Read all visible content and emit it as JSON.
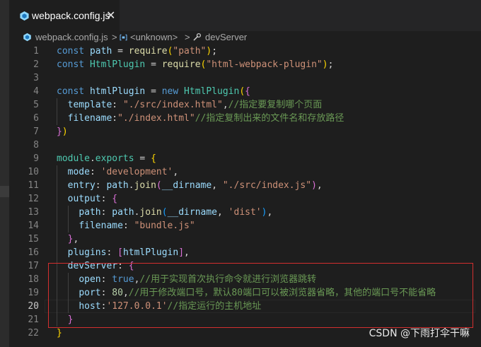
{
  "tab": {
    "title": "webpack.config.js",
    "close": "✕"
  },
  "breadcrumb": {
    "file": "webpack.config.js",
    "sep": ">",
    "symbol": "<unknown>",
    "member": "devServer"
  },
  "active_line": 20,
  "code_lines": [
    {
      "n": "1",
      "tokens": [
        [
          "kw",
          "const "
        ],
        [
          "var",
          "path"
        ],
        [
          "p",
          " = "
        ],
        [
          "fn",
          "require"
        ],
        [
          "br1",
          "("
        ],
        [
          "str",
          "\"path\""
        ],
        [
          "br1",
          ")"
        ],
        [
          "p",
          ";"
        ]
      ]
    },
    {
      "n": "2",
      "tokens": [
        [
          "kw",
          "const "
        ],
        [
          "cls",
          "HtmlPlugin"
        ],
        [
          "p",
          " = "
        ],
        [
          "fn",
          "require"
        ],
        [
          "br1",
          "("
        ],
        [
          "str",
          "\"html-webpack-plugin\""
        ],
        [
          "br1",
          ")"
        ],
        [
          "p",
          ";"
        ]
      ]
    },
    {
      "n": "3",
      "tokens": []
    },
    {
      "n": "4",
      "tokens": [
        [
          "kw",
          "const "
        ],
        [
          "var",
          "htmlPlugin"
        ],
        [
          "p",
          " = "
        ],
        [
          "kw",
          "new "
        ],
        [
          "cls",
          "HtmlPlugin"
        ],
        [
          "br1",
          "("
        ],
        [
          "br2",
          "{"
        ]
      ]
    },
    {
      "n": "5",
      "tokens": [
        [
          "p",
          "  "
        ],
        [
          "var",
          "template"
        ],
        [
          "p",
          ": "
        ],
        [
          "str",
          "\"./src/index.html\""
        ],
        [
          "p",
          ","
        ],
        [
          "cmt",
          "//指定要复制哪个页面"
        ]
      ]
    },
    {
      "n": "6",
      "tokens": [
        [
          "p",
          "  "
        ],
        [
          "var",
          "filename"
        ],
        [
          "p",
          ":"
        ],
        [
          "str",
          "\"./index.html\""
        ],
        [
          "cmt",
          "//指定复制出来的文件名和存放路径"
        ]
      ]
    },
    {
      "n": "7",
      "tokens": [
        [
          "br2",
          "}"
        ],
        [
          "br1",
          ")"
        ]
      ]
    },
    {
      "n": "8",
      "tokens": []
    },
    {
      "n": "9",
      "tokens": [
        [
          "cls",
          "module"
        ],
        [
          "p",
          "."
        ],
        [
          "cls",
          "exports"
        ],
        [
          "p",
          " = "
        ],
        [
          "br1",
          "{"
        ]
      ]
    },
    {
      "n": "10",
      "tokens": [
        [
          "p",
          "  "
        ],
        [
          "var",
          "mode"
        ],
        [
          "p",
          ": "
        ],
        [
          "str",
          "'development'"
        ],
        [
          "p",
          ","
        ]
      ]
    },
    {
      "n": "11",
      "tokens": [
        [
          "p",
          "  "
        ],
        [
          "var",
          "entry"
        ],
        [
          "p",
          ": "
        ],
        [
          "var",
          "path"
        ],
        [
          "p",
          "."
        ],
        [
          "fn",
          "join"
        ],
        [
          "br2",
          "("
        ],
        [
          "var",
          "__dirname"
        ],
        [
          "p",
          ", "
        ],
        [
          "str",
          "\"./src/index.js\""
        ],
        [
          "br2",
          ")"
        ],
        [
          "p",
          ","
        ]
      ]
    },
    {
      "n": "12",
      "tokens": [
        [
          "p",
          "  "
        ],
        [
          "var",
          "output"
        ],
        [
          "p",
          ": "
        ],
        [
          "br2",
          "{"
        ]
      ]
    },
    {
      "n": "13",
      "tokens": [
        [
          "p",
          "    "
        ],
        [
          "var",
          "path"
        ],
        [
          "p",
          ": "
        ],
        [
          "var",
          "path"
        ],
        [
          "p",
          "."
        ],
        [
          "fn",
          "join"
        ],
        [
          "br3",
          "("
        ],
        [
          "var",
          "__dirname"
        ],
        [
          "p",
          ", "
        ],
        [
          "str",
          "'dist'"
        ],
        [
          "br3",
          ")"
        ],
        [
          "p",
          ","
        ]
      ]
    },
    {
      "n": "14",
      "tokens": [
        [
          "p",
          "    "
        ],
        [
          "var",
          "filename"
        ],
        [
          "p",
          ": "
        ],
        [
          "str",
          "\"bundle.js\""
        ]
      ]
    },
    {
      "n": "15",
      "tokens": [
        [
          "p",
          "  "
        ],
        [
          "br2",
          "}"
        ],
        [
          "p",
          ","
        ]
      ]
    },
    {
      "n": "16",
      "tokens": [
        [
          "p",
          "  "
        ],
        [
          "var",
          "plugins"
        ],
        [
          "p",
          ": "
        ],
        [
          "br2",
          "["
        ],
        [
          "var",
          "htmlPlugin"
        ],
        [
          "br2",
          "]"
        ],
        [
          "p",
          ","
        ]
      ]
    },
    {
      "n": "17",
      "tokens": [
        [
          "p",
          "  "
        ],
        [
          "var",
          "devServer"
        ],
        [
          "p",
          ": "
        ],
        [
          "br2",
          "{"
        ]
      ]
    },
    {
      "n": "18",
      "tokens": [
        [
          "p",
          "    "
        ],
        [
          "var",
          "open"
        ],
        [
          "p",
          ": "
        ],
        [
          "kw",
          "true"
        ],
        [
          "p",
          ","
        ],
        [
          "cmt",
          "//用于实现首次执行命令就进行浏览器跳转"
        ]
      ]
    },
    {
      "n": "19",
      "tokens": [
        [
          "p",
          "    "
        ],
        [
          "var",
          "port"
        ],
        [
          "p",
          ": "
        ],
        [
          "num",
          "80"
        ],
        [
          "p",
          ","
        ],
        [
          "cmt",
          "//用于修改端口号，默认80端口可以被浏览器省略，其他的端口号不能省略"
        ]
      ]
    },
    {
      "n": "20",
      "tokens": [
        [
          "p",
          "    "
        ],
        [
          "var",
          "host"
        ],
        [
          "p",
          ":"
        ],
        [
          "str",
          "'127.0.0.1'"
        ],
        [
          "cmt",
          "//指定运行的主机地址"
        ]
      ]
    },
    {
      "n": "21",
      "tokens": [
        [
          "p",
          "  "
        ],
        [
          "br2",
          "}"
        ]
      ]
    },
    {
      "n": "22",
      "tokens": [
        [
          "br1",
          "}"
        ]
      ]
    }
  ],
  "watermark": "CSDN @下雨打伞干嘛"
}
